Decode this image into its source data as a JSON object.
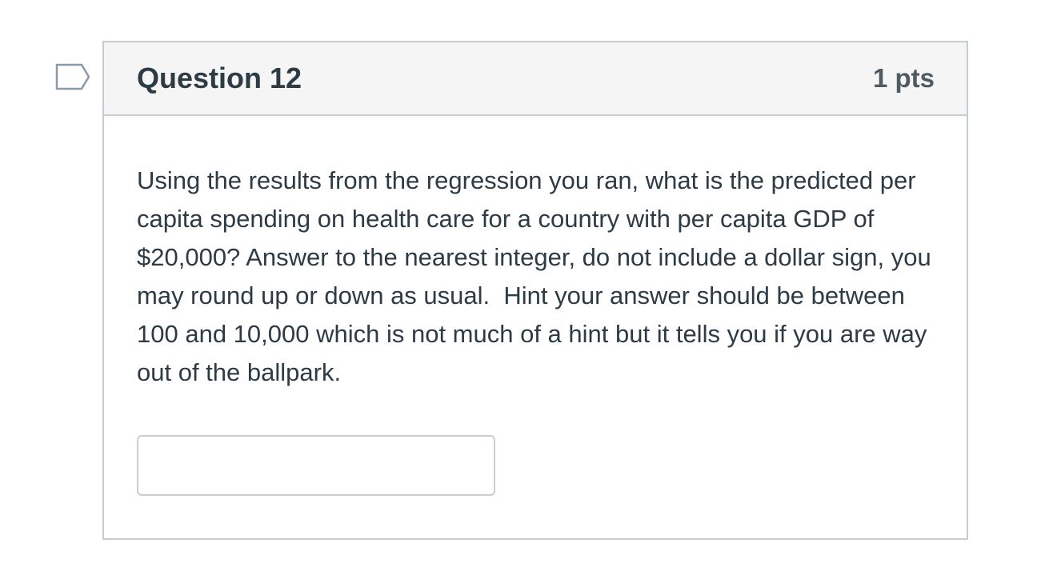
{
  "question": {
    "title": "Question 12",
    "points": "1 pts",
    "text": "Using the results from the regression you ran, what is the predicted per capita spending on health care for a country with per capita GDP of $20,000? Answer to the nearest integer, do not include a dollar sign, you may round up or down as usual.  Hint your answer should be between 100 and 10,000 which is not much of a hint but it tells you if you are way out of the ballpark.",
    "answer_value": "",
    "flag_icon": "flag-icon"
  },
  "colors": {
    "border": "#c7cdd1",
    "header_bg": "#f5f5f5",
    "text": "#2d3b45",
    "flag_stroke": "#8a9aa8"
  }
}
